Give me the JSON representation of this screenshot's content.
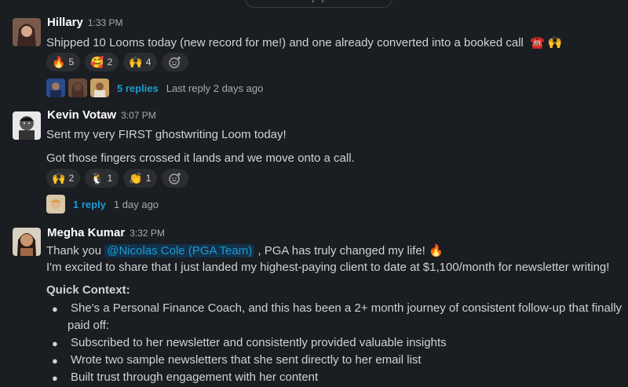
{
  "messages": [
    {
      "author": "Hillary",
      "time": "1:33 PM",
      "text": "Shipped 10 Looms today (new record for me!) and one already converted into a booked call",
      "trailing_emoji": "☎️  🙌",
      "reactions": [
        {
          "emoji": "🔥",
          "count": "5"
        },
        {
          "emoji": "🥰",
          "count": "2"
        },
        {
          "emoji": "🙌",
          "count": "4"
        }
      ],
      "thread": {
        "replies": "5 replies",
        "last": "Last reply 2 days ago"
      }
    },
    {
      "author": "Kevin Votaw",
      "time": "3:07 PM",
      "lines": [
        "Sent my very FIRST ghostwriting Loom today!",
        "Got those fingers crossed it lands and we move onto a call."
      ],
      "reactions": [
        {
          "emoji": "🙌",
          "count": "2"
        },
        {
          "emoji": "🐧",
          "count": "1"
        },
        {
          "emoji": "👏",
          "count": "1"
        }
      ],
      "thread": {
        "replies": "1 reply",
        "last": "1 day ago"
      }
    },
    {
      "author": "Megha Kumar",
      "time": "3:32 PM",
      "thank_prefix": "Thank you",
      "mention": "@Nicolas Cole (PGA Team)",
      "thank_suffix": ", PGA has truly changed my life!",
      "thank_emoji": "🔥",
      "line2": "I'm excited to share that I just landed my highest-paying client to date at $1,100/month for newsletter writing!",
      "context_title": "Quick Context:",
      "bullets": [
        "She's a Personal Finance Coach, and this has been a 2+ month journey of consistent follow-up that finally",
        "paid off:",
        "Subscribed to her newsletter and consistently provided valuable insights",
        "Wrote two sample newsletters that she sent directly to her email list",
        "Built  trust through engagement with her content"
      ]
    }
  ],
  "icons": {
    "add_reaction": "add-reaction-icon"
  }
}
